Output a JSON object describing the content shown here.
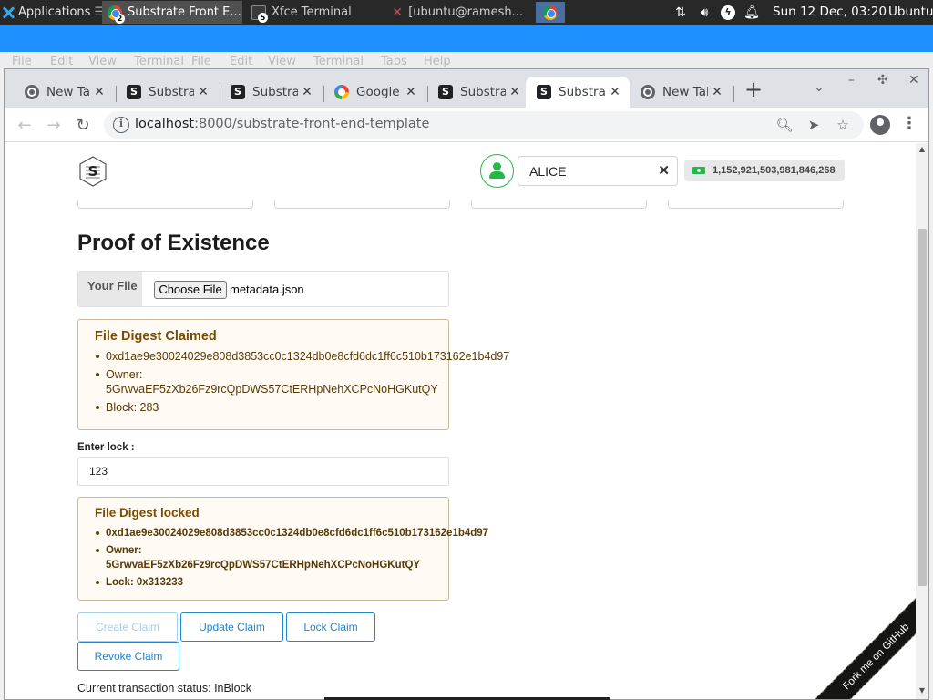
{
  "panel": {
    "applications": "Applications",
    "menu_symbol": "☰",
    "tasks": [
      {
        "label": "Substrate Front E...",
        "badge": "2"
      },
      {
        "label": "Xfce Terminal",
        "badge": "5"
      },
      {
        "label": "[ubuntu@ramesh..."
      }
    ],
    "clock": "Sun 12 Dec, 03:20",
    "user": "Ubuntu"
  },
  "bg_terminal_menu": [
    "File",
    "Edit",
    "View",
    "Terminal",
    "File",
    "Edit",
    "View",
    "Terminal",
    "Tabs",
    "Help"
  ],
  "browser": {
    "tabs": [
      {
        "title": "New Tab",
        "icon": "chrome-icon"
      },
      {
        "title": "Substrate",
        "icon": "substrate-icon"
      },
      {
        "title": "Substrate",
        "icon": "substrate-icon"
      },
      {
        "title": "Google",
        "icon": "google-icon"
      },
      {
        "title": "Substrate",
        "icon": "substrate-icon"
      },
      {
        "title": "Substrate",
        "icon": "substrate-icon",
        "active": true
      },
      {
        "title": "New Tab",
        "icon": "chrome-icon"
      }
    ],
    "url_host": "localhost",
    "url_rest": ":8000/substrate-front-end-template"
  },
  "app": {
    "account_name": "ALICE",
    "balance": "1,152,921,503,981,846,268",
    "heading": "Proof of Existence",
    "file_label": "Your File",
    "choose_button": "Choose File",
    "file_name": "metadata.json",
    "claimed": {
      "header": "File Digest Claimed",
      "digest": "0xd1ae9e30024029e808d3853cc0c1324db0e8cfd6dc1ff6c510b173162e1b4d97",
      "owner_label": "Owner:",
      "owner": "5GrwvaEF5zXb26Fz9rcQpDWS57CtERHpNehXCPcNoHGKutQY",
      "block": "Block: 283"
    },
    "lock_label": "Enter lock :",
    "lock_value": "123",
    "locked": {
      "header": "File Digest locked",
      "digest": "0xd1ae9e30024029e808d3853cc0c1324db0e8cfd6dc1ff6c510b173162e1b4d97",
      "owner_label": "Owner:",
      "owner": "5GrwvaEF5zXb26Fz9rcQpDWS57CtERHpNehXCPcNoHGKutQY",
      "lock": "Lock: 0x313233"
    },
    "buttons": {
      "create": "Create Claim",
      "update": "Update Claim",
      "lock": "Lock Claim",
      "revoke": "Revoke Claim"
    },
    "status": "Current transaction status: InBlock",
    "fork": "Fork me on GitHub"
  },
  "colors": {
    "accent_blue": "#2185d0",
    "success_green": "#21ba45",
    "warning_bg": "#fffaf3",
    "warning_text": "#794b02"
  }
}
